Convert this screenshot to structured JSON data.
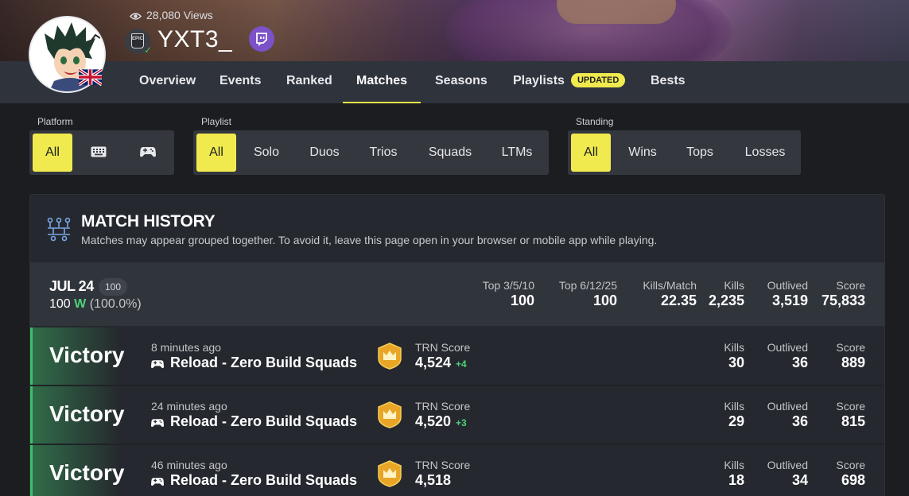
{
  "profile": {
    "views": "28,080 Views",
    "username": "YXT3_",
    "avatar_icon": "anime-avatar",
    "flag_icon": "uk-flag-icon",
    "platform_icon": "epic-games-icon",
    "verified_icon": "check-icon",
    "twitch_icon": "twitch-icon",
    "epic_text": "EPIC"
  },
  "nav": {
    "items": [
      {
        "label": "Overview"
      },
      {
        "label": "Events"
      },
      {
        "label": "Ranked"
      },
      {
        "label": "Matches",
        "active": true
      },
      {
        "label": "Seasons"
      },
      {
        "label": "Playlists",
        "badge": "UPDATED"
      },
      {
        "label": "Bests"
      }
    ]
  },
  "filters": {
    "platform": {
      "label": "Platform",
      "options": [
        {
          "label": "All",
          "active": true
        },
        {
          "icon": "keyboard-icon"
        },
        {
          "icon": "gamepad-icon"
        }
      ]
    },
    "playlist": {
      "label": "Playlist",
      "options": [
        {
          "label": "All",
          "active": true
        },
        {
          "label": "Solo"
        },
        {
          "label": "Duos"
        },
        {
          "label": "Trios"
        },
        {
          "label": "Squads"
        },
        {
          "label": "LTMs"
        }
      ]
    },
    "standing": {
      "label": "Standing",
      "options": [
        {
          "label": "All",
          "active": true
        },
        {
          "label": "Wins"
        },
        {
          "label": "Tops"
        },
        {
          "label": "Losses"
        }
      ]
    }
  },
  "match_history": {
    "title": "MATCH HISTORY",
    "subtitle": "Matches may appear grouped together. To avoid it, leave this page open in your browser or mobile app while playing.",
    "icon": "network-icon"
  },
  "day": {
    "date": "JUL 24",
    "count": "100",
    "wins_number": "100",
    "wins_letter": "W",
    "wins_pct": "(100.0%)",
    "stats": [
      {
        "label": "Top 3/5/10",
        "value": "100"
      },
      {
        "label": "Top 6/12/25",
        "value": "100"
      },
      {
        "label": "Kills/Match",
        "value": "22.35"
      },
      {
        "label": "Kills",
        "value": "2,235"
      },
      {
        "label": "Outlived",
        "value": "3,519"
      },
      {
        "label": "Score",
        "value": "75,833"
      }
    ]
  },
  "matches": [
    {
      "result": "Victory",
      "ago": "8 minutes ago",
      "mode": "Reload - Zero Build Squads",
      "trn_label": "TRN Score",
      "trn_value": "4,524",
      "trn_delta": "+4",
      "kills_label": "Kills",
      "kills": "30",
      "outlived_label": "Outlived",
      "outlived": "36",
      "score_label": "Score",
      "score": "889"
    },
    {
      "result": "Victory",
      "ago": "24 minutes ago",
      "mode": "Reload - Zero Build Squads",
      "trn_label": "TRN Score",
      "trn_value": "4,520",
      "trn_delta": "+3",
      "kills_label": "Kills",
      "kills": "29",
      "outlived_label": "Outlived",
      "outlived": "36",
      "score_label": "Score",
      "score": "815"
    },
    {
      "result": "Victory",
      "ago": "46 minutes ago",
      "mode": "Reload - Zero Build Squads",
      "trn_label": "TRN Score",
      "trn_value": "4,518",
      "trn_delta": "",
      "kills_label": "Kills",
      "kills": "18",
      "outlived_label": "Outlived",
      "outlived": "34",
      "score_label": "Score",
      "score": "698"
    }
  ],
  "colors": {
    "accent": "#f0ea4e",
    "win_green": "#3fbf68",
    "background": "#1b1d21",
    "twitch": "#7b52c7"
  }
}
